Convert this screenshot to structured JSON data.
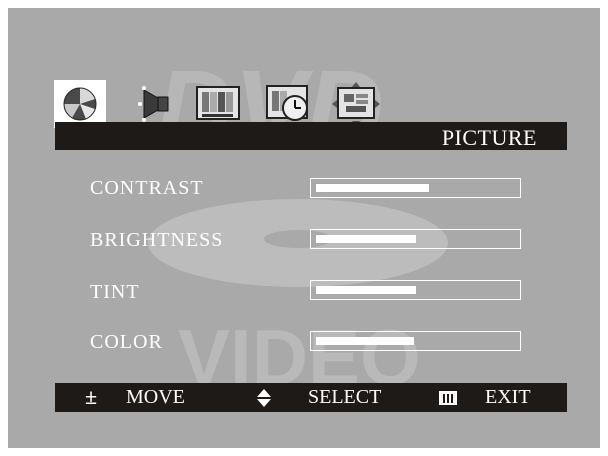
{
  "tabs": [
    {
      "name": "picture-tab",
      "icon": "color-wheel-icon",
      "active": true
    },
    {
      "name": "audio-tab",
      "icon": "speaker-icon",
      "active": false
    },
    {
      "name": "display-tab",
      "icon": "tv-screen-icon",
      "active": false
    },
    {
      "name": "timer-tab",
      "icon": "clock-icon",
      "active": false
    },
    {
      "name": "setup-tab",
      "icon": "position-icon",
      "active": false
    }
  ],
  "header": {
    "title": "PICTURE"
  },
  "watermark": {
    "line1": "DVD",
    "line2": "VIDEO"
  },
  "settings": [
    {
      "label": "CONTRAST",
      "level": 0.57
    },
    {
      "label": "BRIGHTNESS",
      "level": 0.5
    },
    {
      "label": "TINT",
      "level": 0.5
    },
    {
      "label": "COLOR",
      "level": 0.49
    }
  ],
  "footer": {
    "move_icon": "±",
    "move_label": "MOVE",
    "select_icon": "up-down-arrows-icon",
    "select_label": "SELECT",
    "exit_icon": "menu-icon",
    "exit_label": "EXIT"
  },
  "colors": {
    "background": "#a9a9a9",
    "bar_dark": "#1e1a17",
    "text": "#ffffff",
    "watermark": "#b8b8b8"
  }
}
